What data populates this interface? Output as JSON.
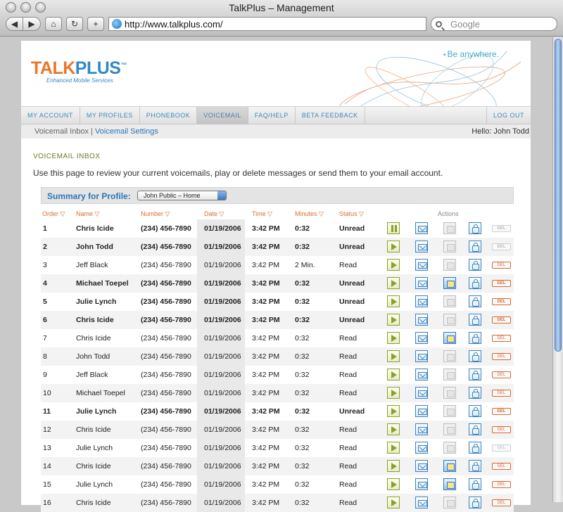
{
  "window": {
    "title": "TalkPlus – Management"
  },
  "browser": {
    "url": "http://www.talkplus.com/",
    "search_placeholder": "Google"
  },
  "brand": {
    "name_part1": "TALK",
    "name_part2": "PLUS",
    "tm": "™",
    "subtitle": "Enhanced Mobile Services",
    "tagline": "Be anywhere."
  },
  "nav": {
    "items": [
      "MY ACCOUNT",
      "MY PROFILES",
      "PHONEBOOK",
      "VOICEMAIL",
      "FAQ/HELP",
      "BETA FEEDBACK"
    ],
    "active": "VOICEMAIL",
    "logout": "LOG OUT"
  },
  "subnav": {
    "current": "Voicemail Inbox",
    "separator": "|",
    "link": "Voicemail Settings",
    "greeting": "Hello: John Todd"
  },
  "page": {
    "heading": "VOICEMAIL INBOX",
    "intro": "Use this page to review your current voicemails, play or delete messages or send them to your email account."
  },
  "summary": {
    "label": "Summary for Profile:",
    "selected_profile": "John Public – Home"
  },
  "table": {
    "columns": [
      "Order ▽",
      "Name ▽",
      "Number ▽",
      "Date ▽",
      "Time ▽",
      "Minutes ▽",
      "Status ▽",
      "Actions"
    ],
    "delete_label": "DEL",
    "rows": [
      {
        "order": "1",
        "name": "Chris Icide",
        "number": "(234) 456-7890",
        "date": "01/19/2006",
        "time": "3:42 PM",
        "minutes": "0:32",
        "status": "Unread",
        "bold": true,
        "playing": true,
        "forward_active": false,
        "action4": "lock",
        "delete_active": false
      },
      {
        "order": "2",
        "name": "John Todd",
        "number": "(234) 456-7890",
        "date": "01/19/2006",
        "time": "3:42 PM",
        "minutes": "0:32",
        "status": "Unread",
        "bold": true,
        "playing": false,
        "forward_active": false,
        "action4": "lock",
        "delete_active": false
      },
      {
        "order": "3",
        "name": "Jeff Black",
        "number": "(234) 456-7890",
        "date": "01/19/2006",
        "time": "3:42 PM",
        "minutes": "2 Min.",
        "status": "Read",
        "bold": false,
        "playing": false,
        "forward_active": false,
        "action4": "unlock",
        "delete_active": true
      },
      {
        "order": "4",
        "name": "Michael Toepel",
        "number": "(234) 456-7890",
        "date": "01/19/2006",
        "time": "3:42 PM",
        "minutes": "0:32",
        "status": "Unread",
        "bold": true,
        "playing": false,
        "forward_active": true,
        "action4": "unlock",
        "delete_active": true
      },
      {
        "order": "5",
        "name": "Julie Lynch",
        "number": "(234) 456-7890",
        "date": "01/19/2006",
        "time": "3:42 PM",
        "minutes": "0:32",
        "status": "Unread",
        "bold": true,
        "playing": false,
        "forward_active": false,
        "action4": "unlock",
        "delete_active": true
      },
      {
        "order": "6",
        "name": "Chris Icide",
        "number": "(234) 456-7890",
        "date": "01/19/2006",
        "time": "3:42 PM",
        "minutes": "0:32",
        "status": "Unread",
        "bold": true,
        "playing": false,
        "forward_active": false,
        "action4": "unlock",
        "delete_active": true
      },
      {
        "order": "7",
        "name": "Chris Icide",
        "number": "(234) 456-7890",
        "date": "01/19/2006",
        "time": "3:42 PM",
        "minutes": "0:32",
        "status": "Read",
        "bold": false,
        "playing": false,
        "forward_active": true,
        "action4": "unlock",
        "delete_active": true
      },
      {
        "order": "8",
        "name": "John Todd",
        "number": "(234) 456-7890",
        "date": "01/19/2006",
        "time": "3:42 PM",
        "minutes": "0:32",
        "status": "Read",
        "bold": false,
        "playing": false,
        "forward_active": false,
        "action4": "unlock",
        "delete_active": true
      },
      {
        "order": "9",
        "name": "Jeff Black",
        "number": "(234) 456-7890",
        "date": "01/19/2006",
        "time": "3:42 PM",
        "minutes": "0:32",
        "status": "Read",
        "bold": false,
        "playing": false,
        "forward_active": false,
        "action4": "unlock",
        "delete_active": true
      },
      {
        "order": "10",
        "name": "Michael Toepel",
        "number": "(234) 456-7890",
        "date": "01/19/2006",
        "time": "3:42 PM",
        "minutes": "0:32",
        "status": "Read",
        "bold": false,
        "playing": false,
        "forward_active": false,
        "action4": "unlock",
        "delete_active": true
      },
      {
        "order": "11",
        "name": "Julie Lynch",
        "number": "(234) 456-7890",
        "date": "01/19/2006",
        "time": "3:42 PM",
        "minutes": "0:32",
        "status": "Unread",
        "bold": true,
        "playing": false,
        "forward_active": false,
        "action4": "unlock",
        "delete_active": true
      },
      {
        "order": "12",
        "name": "Chris Icide",
        "number": "(234) 456-7890",
        "date": "01/19/2006",
        "time": "3:42 PM",
        "minutes": "0:32",
        "status": "Read",
        "bold": false,
        "playing": false,
        "forward_active": false,
        "action4": "unlock",
        "delete_active": true
      },
      {
        "order": "13",
        "name": "Julie Lynch",
        "number": "(234) 456-7890",
        "date": "01/19/2006",
        "time": "3:42 PM",
        "minutes": "0:32",
        "status": "Read",
        "bold": false,
        "playing": false,
        "forward_active": false,
        "action4": "unlock",
        "delete_active": false
      },
      {
        "order": "14",
        "name": "Chris Icide",
        "number": "(234) 456-7890",
        "date": "01/19/2006",
        "time": "3:42 PM",
        "minutes": "0:32",
        "status": "Read",
        "bold": false,
        "playing": false,
        "forward_active": true,
        "action4": "unlock",
        "delete_active": true
      },
      {
        "order": "15",
        "name": "Julie Lynch",
        "number": "(234) 456-7890",
        "date": "01/19/2006",
        "time": "3:42 PM",
        "minutes": "0:32",
        "status": "Read",
        "bold": false,
        "playing": false,
        "forward_active": true,
        "action4": "unlock",
        "delete_active": true
      },
      {
        "order": "16",
        "name": "Chris Icide",
        "number": "(234) 456-7890",
        "date": "01/19/2006",
        "time": "3:42 PM",
        "minutes": "0:32",
        "status": "Read",
        "bold": false,
        "playing": false,
        "forward_active": false,
        "action4": "unlock",
        "delete_active": true
      }
    ]
  },
  "colors": {
    "brand_orange": "#e9762b",
    "brand_blue": "#3389c4",
    "heading_olive": "#6b7d26",
    "header_orange": "#d4702e"
  }
}
